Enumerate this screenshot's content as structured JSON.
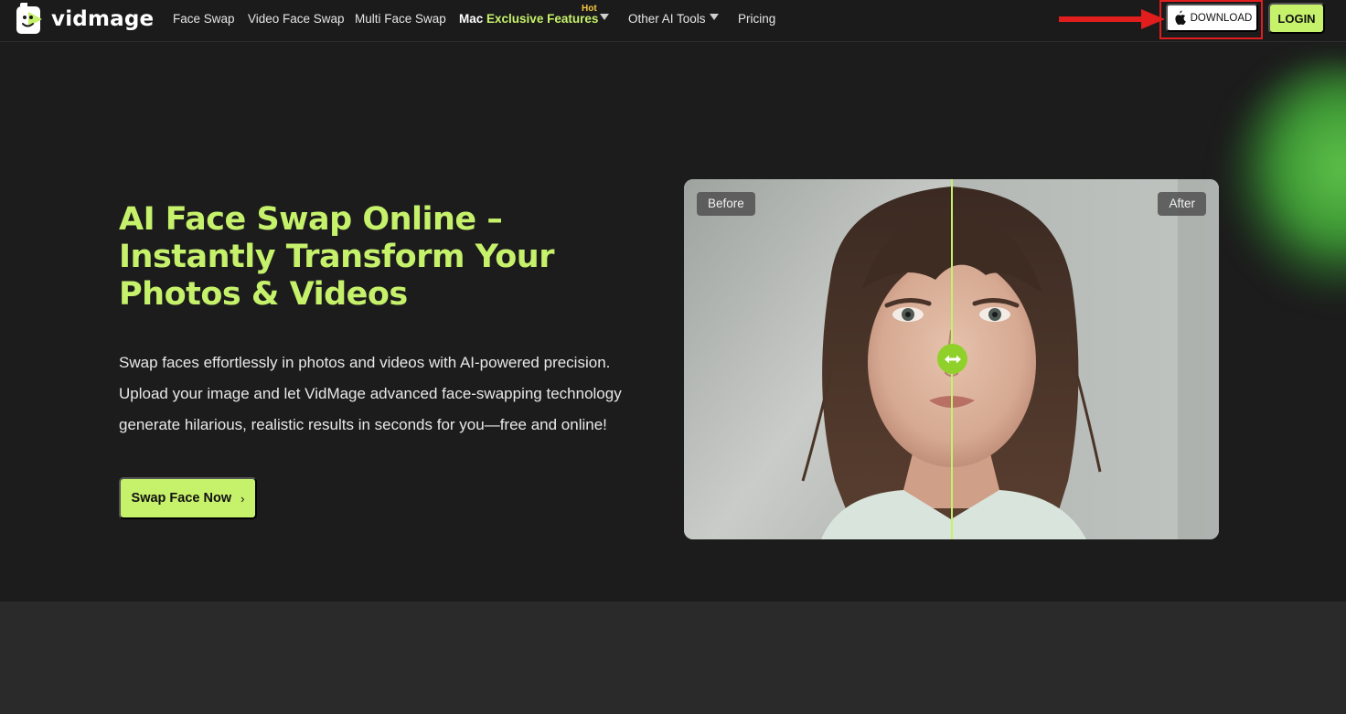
{
  "brand": {
    "name": "vidmage",
    "accent": "#c6f16b"
  },
  "nav": {
    "items": [
      {
        "label": "Face Swap"
      },
      {
        "label": "Video Face Swap"
      },
      {
        "label": "Multi Face Swap"
      }
    ],
    "mac": {
      "prefix": "Mac",
      "highlight": "Exclusive Features",
      "badge": "Hot"
    },
    "other_tools": "Other AI Tools",
    "pricing": "Pricing",
    "download_label": "DOWNLOAD",
    "login_label": "LOGIN",
    "annotation_color": "#e11d1d"
  },
  "hero": {
    "title_lines": [
      "AI Face Swap Online –",
      "Instantly Transform Your",
      "Photos & Videos"
    ],
    "description_lines": [
      "Swap faces effortlessly in photos and videos with AI-powered precision.",
      "Upload your image and let VidMage advanced face-swapping technology",
      "generate hilarious, realistic results in seconds for you—free and online!"
    ],
    "cta_label": "Swap Face Now",
    "cta_chevron": "›"
  },
  "compare": {
    "before_label": "Before",
    "after_label": "After",
    "slider_position": 0.5
  },
  "icons": {
    "apple": "apple-icon",
    "arrows": "left-right-arrows-icon",
    "caret": "caret-down-icon",
    "logo": "vidmage-logo-icon"
  }
}
